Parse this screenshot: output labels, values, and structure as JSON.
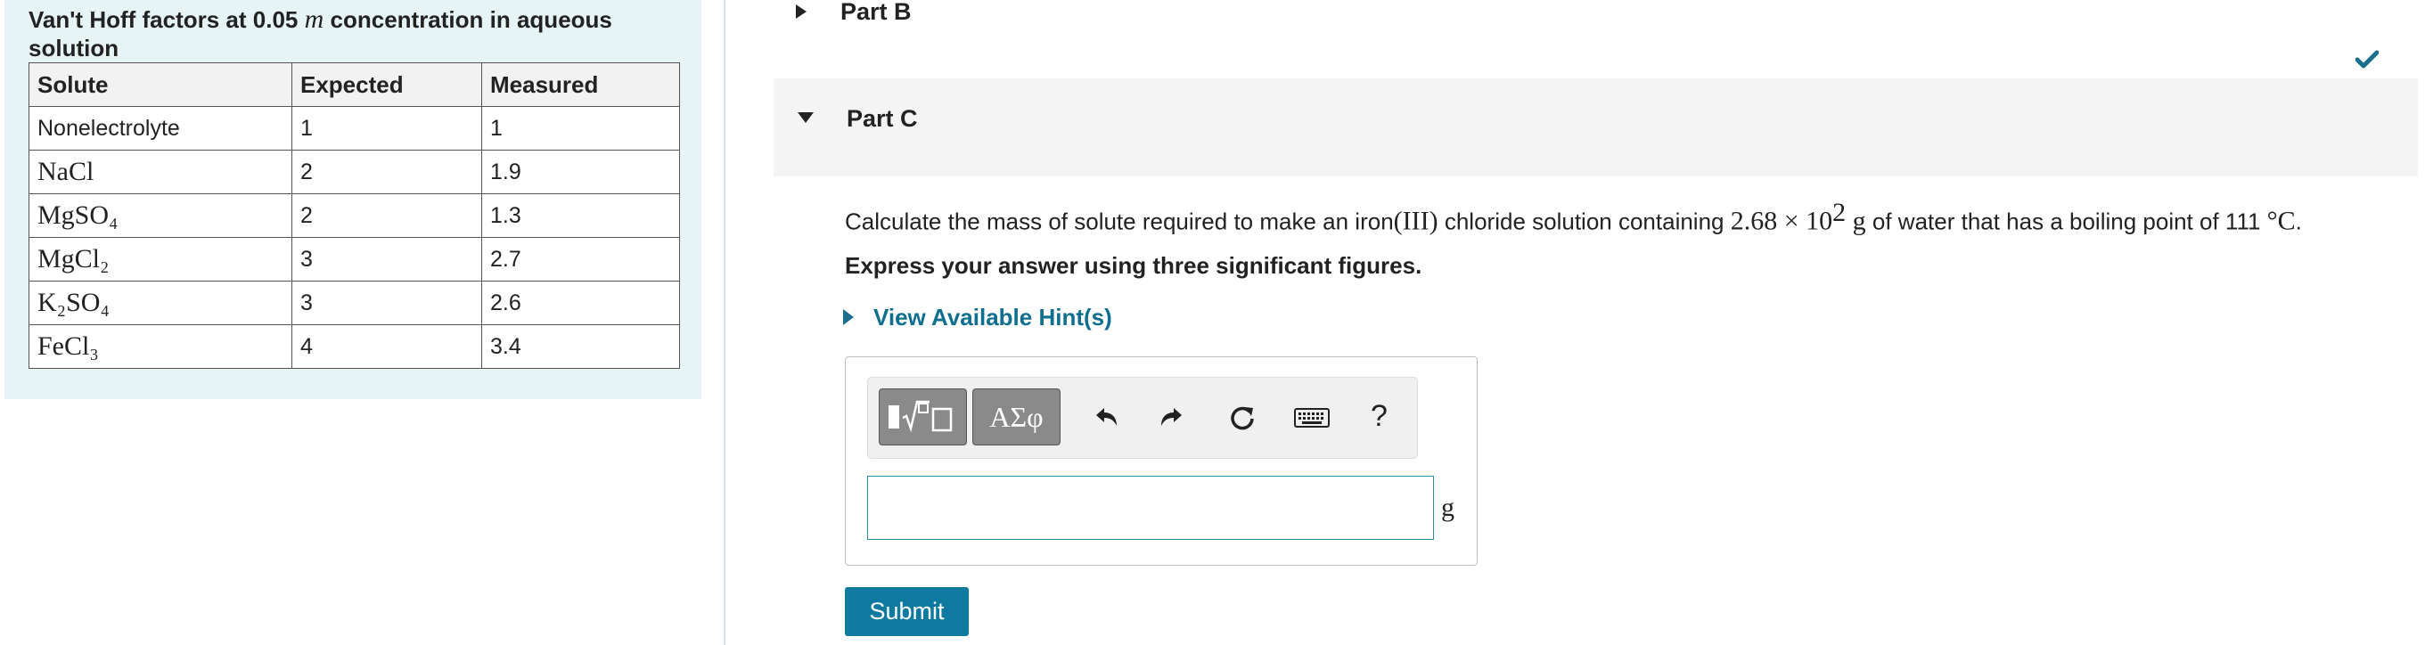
{
  "table": {
    "title_pre": "Van't Hoff factors at 0.05 ",
    "title_var": "m",
    "title_post": " concentration in aqueous solution",
    "headers": [
      "Solute",
      "Expected",
      "Measured"
    ],
    "rows": [
      {
        "solute": "Nonelectrolyte",
        "expected": "1",
        "measured": "1"
      },
      {
        "solute": "NaCl",
        "expected": "2",
        "measured": "1.9"
      },
      {
        "solute": "MgSO₄",
        "expected": "2",
        "measured": "1.3"
      },
      {
        "solute": "MgCl₂",
        "expected": "3",
        "measured": "2.7"
      },
      {
        "solute": "K₂SO₄",
        "expected": "3",
        "measured": "2.6"
      },
      {
        "solute": "FeCl₃",
        "expected": "4",
        "measured": "3.4"
      }
    ]
  },
  "part_b": {
    "label": "Part B",
    "status_icon": "checkmark-icon",
    "status_color": "#1a6f8c"
  },
  "part_c": {
    "label": "Part C",
    "question_1": "Calculate the mass of solute required to make an iron",
    "question_roman": "(III)",
    "question_2": " chloride solution containing ",
    "question_num": "2.68 × 10",
    "question_exp": "2",
    "question_3": " g",
    "question_4": " of water that has a boiling point of 111 ",
    "question_unit": "°C",
    "question_end": ".",
    "instruction": "Express your answer using three significant figures.",
    "hint_link": "View Available Hint(s)"
  },
  "toolbar": {
    "templates_icon": "templates-icon",
    "symbols_label": "ΑΣφ",
    "undo_icon": "undo-icon",
    "redo_icon": "redo-icon",
    "reset_icon": "reset-icon",
    "keyboard_icon": "keyboard-icon",
    "help_label": "?"
  },
  "answer": {
    "value": "",
    "unit": "g"
  },
  "submit_label": "Submit",
  "colors": {
    "accent": "#0e7aa0",
    "panel_bg": "#e6f4f5"
  }
}
